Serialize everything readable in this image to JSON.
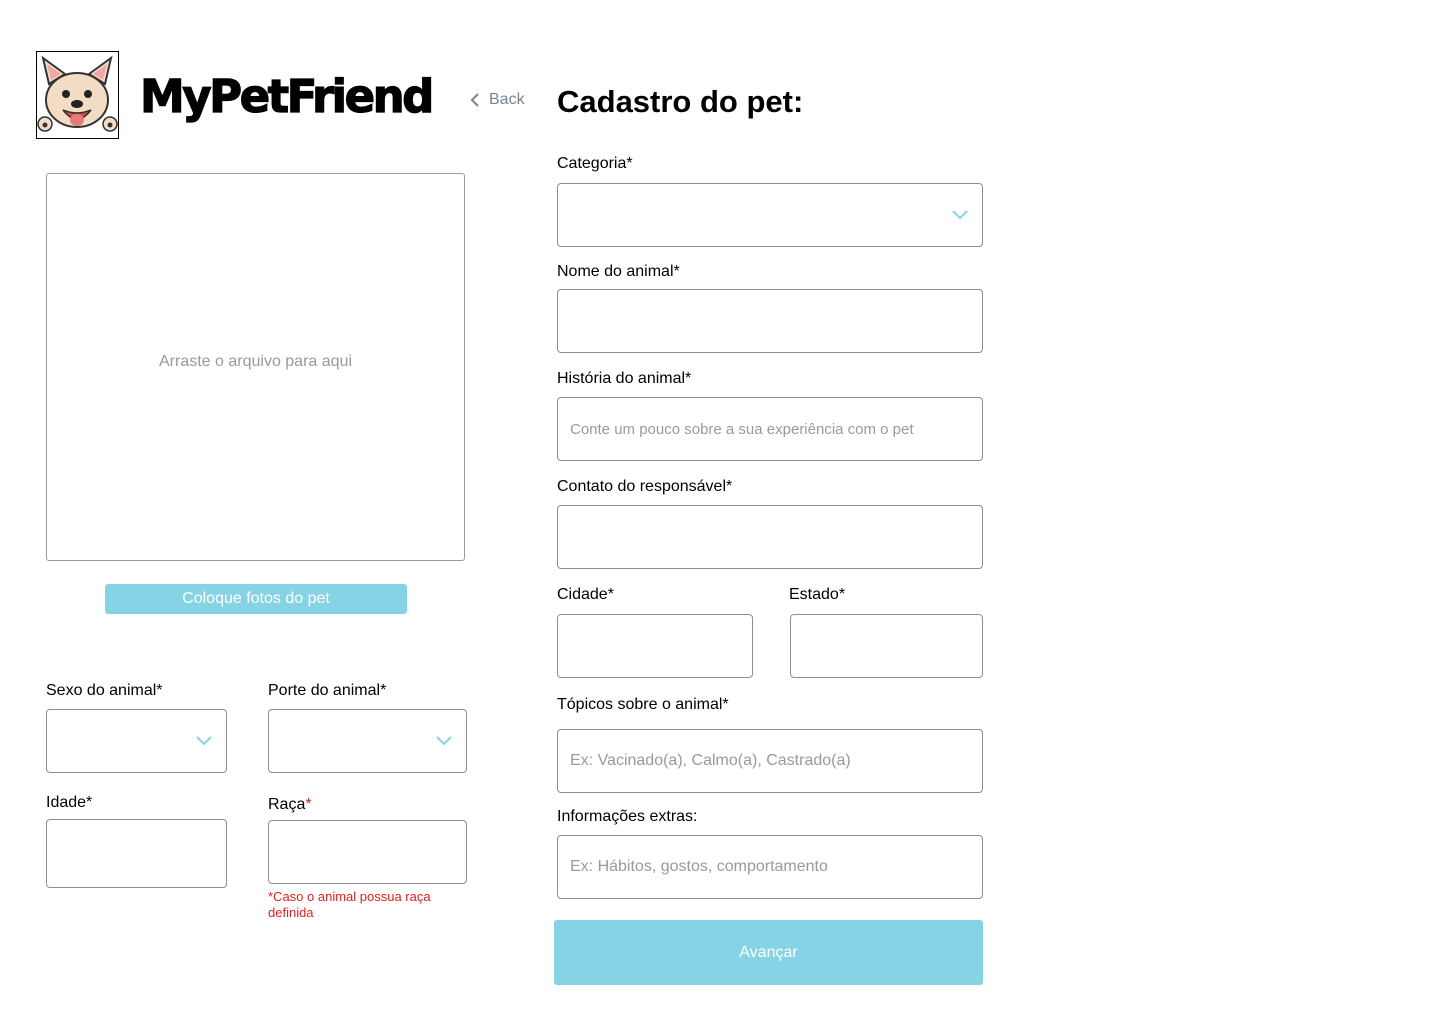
{
  "header": {
    "brand": "MyPetFriend",
    "back_label": "Back",
    "title": "Cadastro do pet:"
  },
  "upload": {
    "dropzone_text": "Arraste o arquivo para aqui",
    "button_label": "Coloque fotos do pet"
  },
  "left_form": {
    "sexo_label": "Sexo do animal*",
    "porte_label": "Porte do animal*",
    "idade_label": "Idade*",
    "raca_label": "Raça",
    "raca_required_mark": "*",
    "raca_note": "*Caso o animal possua raça definida"
  },
  "right_form": {
    "categoria_label": "Categoria*",
    "nome_label": "Nome do animal*",
    "historia_label": "História do animal*",
    "historia_placeholder": "Conte um pouco sobre a sua experiência com o pet",
    "contato_label": "Contato do responsável*",
    "cidade_label": "Cidade*",
    "estado_label": "Estado*",
    "topicos_label": "Tópicos sobre o animal*",
    "topicos_placeholder": "Ex: Vacinado(a), Calmo(a), Castrado(a)",
    "extras_label": "Informações extras:",
    "extras_placeholder": "Ex: Hábitos, gostos, comportamento",
    "submit_label": "Avançar"
  },
  "colors": {
    "accent": "#86d3e5",
    "chevron": "#86d3e5",
    "error": "#e02020",
    "placeholder": "#9a9a9a"
  },
  "icons": {
    "logo": "french-bulldog-logo",
    "back": "chevron-left-icon",
    "select": "chevron-down-icon"
  }
}
